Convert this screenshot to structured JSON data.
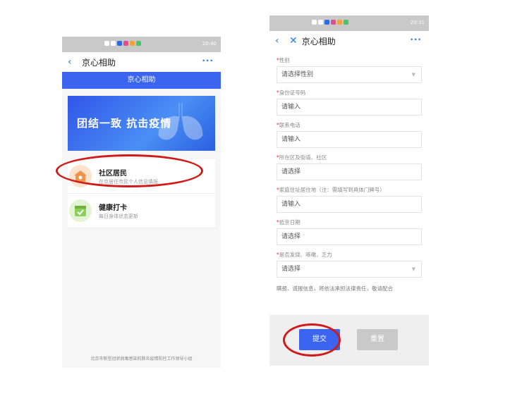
{
  "left": {
    "status_time": "20:40",
    "nav_title": "京心相助",
    "more": "···",
    "blue_bar": "京心相助",
    "banner_text": "团结一致 抗击疫情",
    "items": [
      {
        "title": "社区居民",
        "subtitle": "在京居住市民个人信息填报"
      },
      {
        "title": "健康打卡",
        "subtitle": "每日身体状态更新"
      }
    ],
    "footer": "北京市新型冠状病毒感染的肺炎疫情防控工作领导小组"
  },
  "right": {
    "status_time": "20:31",
    "nav_title": "京心相助",
    "more": "···",
    "fields": [
      {
        "label": "性别",
        "value": "请选择性别",
        "dropdown": true
      },
      {
        "label": "身份证号码",
        "value": "请输入",
        "dropdown": false
      },
      {
        "label": "联系电话",
        "value": "请输入",
        "dropdown": false
      },
      {
        "label": "所在区及街道、社区",
        "value": "请选择",
        "dropdown": false
      },
      {
        "label": "家庭住址居住地（注：需填写到具体门牌号）",
        "value": "请输入",
        "dropdown": false
      },
      {
        "label": "抵京日期",
        "value": "请选择",
        "dropdown": false
      },
      {
        "label": "是否发烧、咳嗽、乏力",
        "value": "请选择",
        "dropdown": true
      }
    ],
    "required_mark": "*",
    "notice": "瞒报、谎报信息，将依法承担法律责任，敬请配合",
    "submit": "提交",
    "reset": "重置"
  },
  "colors": {
    "accent": "#3b64f0",
    "annotation": "#d01a1a",
    "link": "#2a7de1"
  }
}
